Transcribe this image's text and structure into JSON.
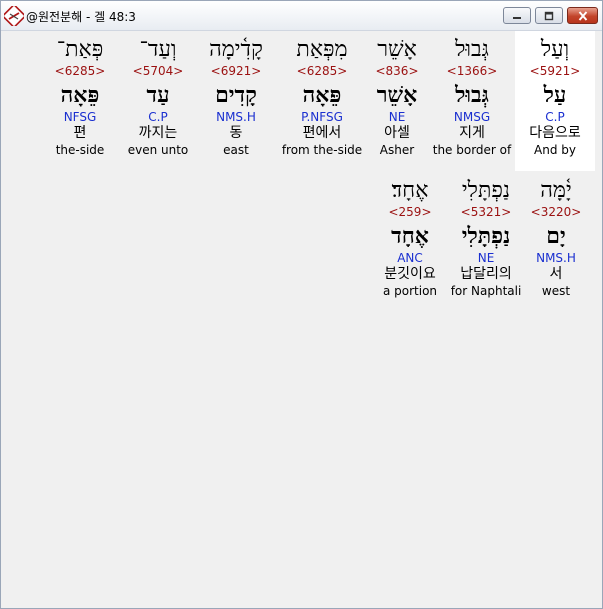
{
  "window": {
    "title": "@원전분해 - 겔 48:3",
    "controls": {
      "minimize": "minimize-icon",
      "maximize": "maximize-icon",
      "close": "close-icon"
    }
  },
  "words": [
    {
      "hebrew": "וְעַל",
      "strong": "<5921>",
      "root": "עַל",
      "parse": "C.P",
      "korean": "다음으로",
      "english": "And by"
    },
    {
      "hebrew": "גְּבוּל",
      "strong": "<1366>",
      "root": "גְּבוּל",
      "parse": "NMSG",
      "korean": "지게",
      "english": "the border of"
    },
    {
      "hebrew": "אָשֵׁר",
      "strong": "<836>",
      "root": "אָשֵׁר",
      "parse": "NE",
      "korean": "아셀",
      "english": "Asher"
    },
    {
      "hebrew": "מִפְּאַת",
      "strong": "<6285>",
      "root": "פֵּאָה",
      "parse": "P.NFSG",
      "korean": "편에서",
      "english": "from the-side"
    },
    {
      "hebrew": "קָדִ֫ימָה",
      "strong": "<6921>",
      "root": "קָדִים",
      "parse": "NMS.H",
      "korean": "동",
      "english": "east"
    },
    {
      "hebrew": "וְעַד־",
      "strong": "<5704>",
      "root": "עַד",
      "parse": "C.P",
      "korean": "까지는",
      "english": "even unto"
    },
    {
      "hebrew": "פְּאַת־",
      "strong": "<6285>",
      "root": "פֵּאָה",
      "parse": "NFSG",
      "korean": "편",
      "english": "the-side"
    },
    {
      "hebrew": "יָ֫מָּה",
      "strong": "<3220>",
      "root": "יָם",
      "parse": "NMS.H",
      "korean": "서",
      "english": "west"
    },
    {
      "hebrew": "נַפְתָּלִי",
      "strong": "<5321>",
      "root": "נַפְתָּלִי",
      "parse": "NE",
      "korean": "납달리의",
      "english": "for Naphtali"
    },
    {
      "hebrew": "אֶחָד׃",
      "strong": "<259>",
      "root": "אֶחָד",
      "parse": "ANC",
      "korean": "분깃이요",
      "english": "a portion"
    }
  ]
}
